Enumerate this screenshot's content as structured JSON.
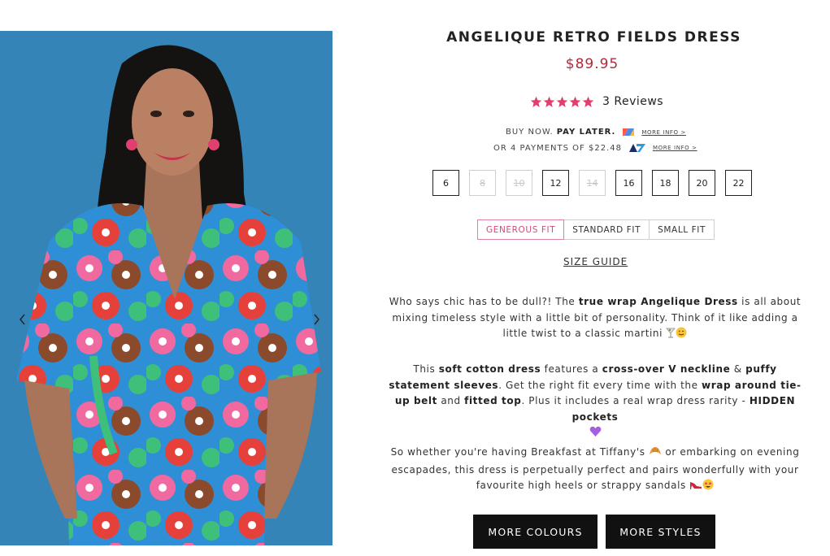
{
  "gallery": {
    "prev_icon": "chevron-left-icon",
    "next_icon": "chevron-right-icon"
  },
  "product": {
    "title": "ANGELIQUE RETRO FIELDS DRESS",
    "price": "$89.95",
    "rating": 5,
    "rating_max": 5,
    "reviews_label": "3 Reviews"
  },
  "payments": {
    "line1_prefix": "BUY NOW.",
    "line1_bold": "PAY LATER.",
    "line1_more": "MORE INFO >",
    "line1_logo": "payment-provider-logo",
    "line2_text": "OR 4 PAYMENTS OF $22.48",
    "line2_more": "MORE INFO >",
    "line2_logo": "instalment-provider-logo"
  },
  "sizes": [
    {
      "label": "6",
      "available": true
    },
    {
      "label": "8",
      "available": false
    },
    {
      "label": "10",
      "available": false
    },
    {
      "label": "12",
      "available": true
    },
    {
      "label": "14",
      "available": false
    },
    {
      "label": "16",
      "available": true
    },
    {
      "label": "18",
      "available": true
    },
    {
      "label": "20",
      "available": true
    },
    {
      "label": "22",
      "available": true
    }
  ],
  "fit": {
    "options": [
      "GENEROUS FIT",
      "STANDARD FIT",
      "SMALL FIT"
    ],
    "selected": "GENEROUS FIT"
  },
  "size_guide": "SIZE GUIDE",
  "description": {
    "p1": {
      "a": "Who says chic has to be dull?! The ",
      "b": "true wrap Angelique Dress",
      "c": " is all about mixing timeless style with a little bit of personality. Think of it like adding a little twist to a classic martini "
    },
    "p2": {
      "a": "This ",
      "b": "soft cotton dress",
      "c": " features a ",
      "d": "cross-over V neckline",
      "e": " & ",
      "f": "puffy statement sleeves",
      "g": ". Get the right fit every time with the ",
      "h": "wrap around tie-up belt",
      "i": " and ",
      "j": "fitted top",
      "k": ". Plus it includes a real wrap dress rarity - ",
      "l": "HIDDEN pockets"
    },
    "p3": {
      "a": "So whether you're having Breakfast at Tiffany's ",
      "b": " or embarking on evening escapades, this dress is perpetually perfect and pairs wonderfully with your favourite high heels or strappy sandals "
    }
  },
  "buttons": {
    "more_colours": "MORE COLOURS",
    "more_styles": "MORE STYLES"
  },
  "colors": {
    "price": "#b02a3c",
    "star": "#e0406f",
    "fit_active": "#d44a7b",
    "button_bg": "#111111",
    "photo_background": "#2f7fb3"
  }
}
